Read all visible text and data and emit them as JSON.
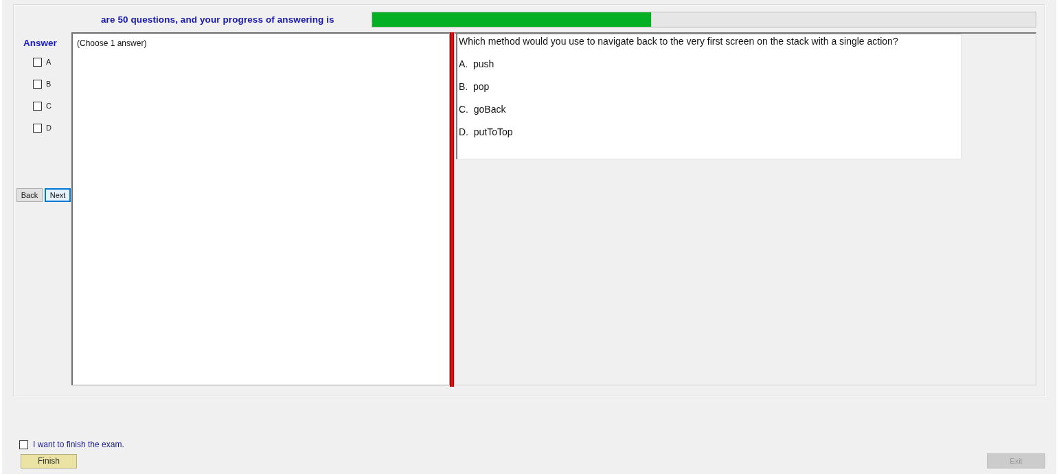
{
  "header": {
    "text": "are 50 questions, and your progress of answering is",
    "progress": {
      "level": 0.42
    }
  },
  "answer_panel": {
    "title": "Answer",
    "options": [
      {
        "label": "A",
        "checked": false
      },
      {
        "label": "B",
        "checked": false
      },
      {
        "label": "C",
        "checked": false
      },
      {
        "label": "D",
        "checked": false
      }
    ],
    "buttons": [
      {
        "label": "Back",
        "focused": false
      },
      {
        "label": "Next",
        "focused": true
      }
    ]
  },
  "instruction_panel": {
    "text": "(Choose 1 answer)"
  },
  "question": {
    "text": "Which method would you use to navigate back to the very first screen on the stack with a single action?",
    "options": [
      "A.  push",
      "B.  pop",
      "C.  goBack",
      "D.  putToTop"
    ]
  },
  "finish": {
    "label": "I want to finish the exam.",
    "checked": false,
    "button": {
      "label": "Finish"
    }
  },
  "exit_button": {
    "label": "Exit",
    "disabled": true
  }
}
